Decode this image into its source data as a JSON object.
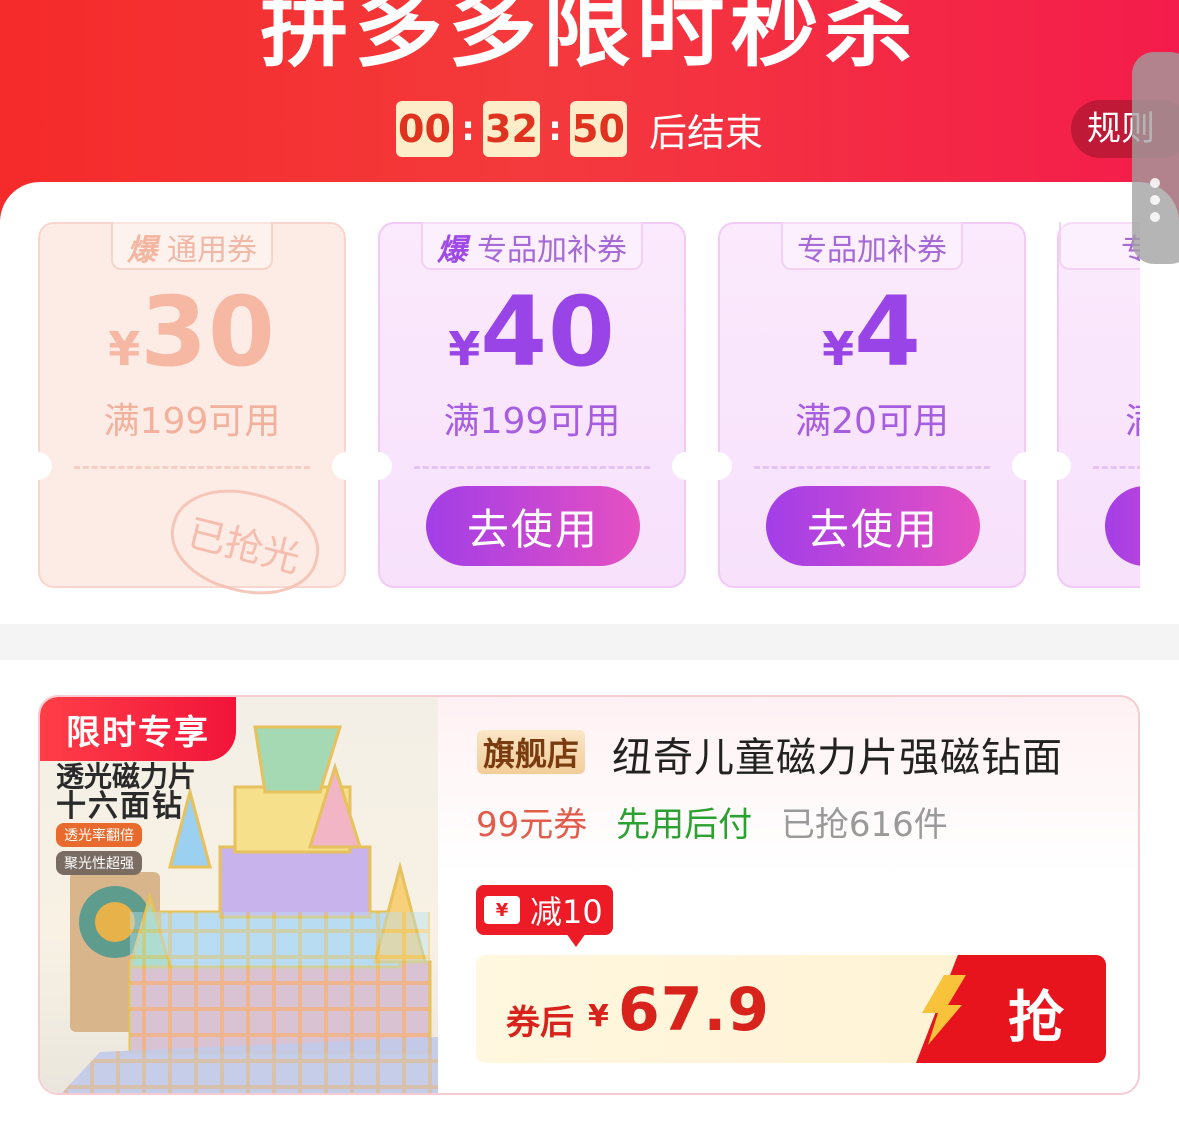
{
  "header": {
    "title": "拼多多限时秒杀",
    "countdown": {
      "hours": "00",
      "minutes": "32",
      "seconds": "50",
      "separator": ":",
      "suffix": "后结束"
    },
    "rules_label": "规则"
  },
  "coupons": [
    {
      "hot_label": "爆",
      "type": "通用券",
      "currency": "¥",
      "amount": "30",
      "condition": "满199可用",
      "status": "已抢光",
      "state": "sold_out"
    },
    {
      "hot_label": "爆",
      "type": "专品加补券",
      "currency": "¥",
      "amount": "40",
      "condition": "满199可用",
      "button": "去使用",
      "state": "available"
    },
    {
      "type": "专品加补券",
      "currency": "¥",
      "amount": "4",
      "condition": "满20可用",
      "button": "去使用",
      "state": "available"
    },
    {
      "type": "专",
      "condition": "满",
      "state": "partial"
    }
  ],
  "product": {
    "limit_tag": "限时专享",
    "image_text": {
      "line1": "透光磁力片",
      "line2": "十六面钻",
      "chip1": "透光率翻倍",
      "chip2": "聚光性超强"
    },
    "shop_badge": "旗舰店",
    "title": "纽奇儿童磁力片强磁钻面",
    "coupon_text": "99元券",
    "pay_later": "先用后付",
    "sold": "已抢616件",
    "reduce": {
      "icon": "¥",
      "label": "减10"
    },
    "price": {
      "label": "券后",
      "currency": "¥",
      "value": "67.9"
    },
    "grab_label": "抢"
  },
  "colors": {
    "header_red": "#f43a3c",
    "coupon_purple": "#9844e6",
    "price_red": "#d8231d",
    "green": "#2aa131"
  }
}
